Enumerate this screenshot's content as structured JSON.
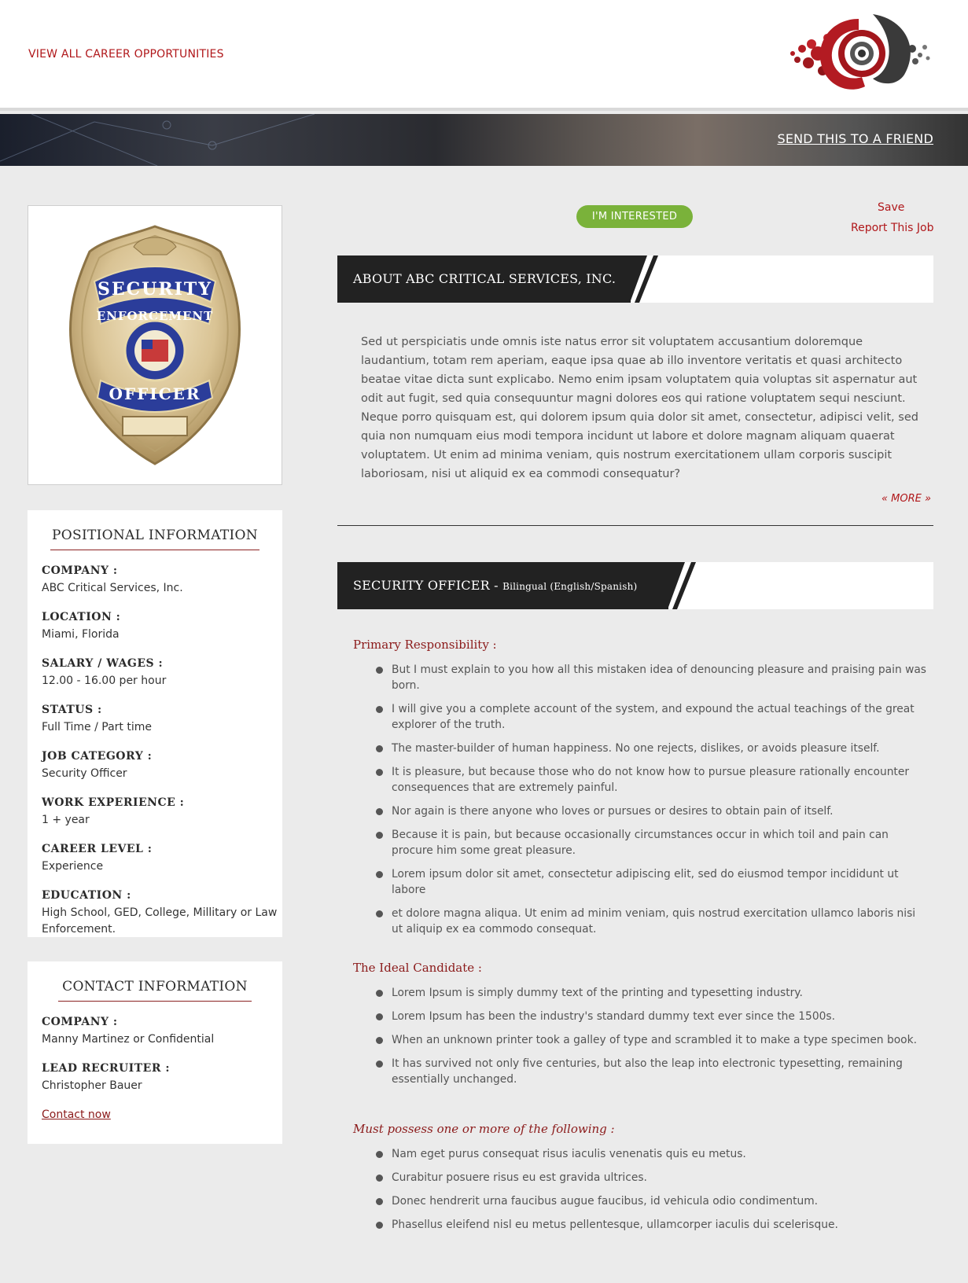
{
  "header": {
    "view_all_label": "VIEW ALL CAREER OPPORTUNITIES",
    "logo_icon": "brand-logo",
    "send_friend_label": "SEND THIS TO A FRIEND"
  },
  "image": {
    "icon": "security-officer-badge",
    "badge_text_top": "SECURITY",
    "badge_text_mid": "ENFORCEMENT",
    "badge_text_bottom": "OFFICER"
  },
  "positional": {
    "title": "POSITIONAL INFORMATION",
    "fields": [
      {
        "label": "COMPANY :",
        "value": "ABC Critical Services, Inc."
      },
      {
        "label": "LOCATION :",
        "value": "Miami, Florida"
      },
      {
        "label": "SALARY / WAGES :",
        "value": "12.00 - 16.00 per hour"
      },
      {
        "label": "STATUS :",
        "value": "Full Time / Part time"
      },
      {
        "label": "JOB CATEGORY :",
        "value": "Security Officer"
      },
      {
        "label": "WORK EXPERIENCE :",
        "value": "1 + year"
      },
      {
        "label": "CAREER LEVEL :",
        "value": "Experience"
      },
      {
        "label": "EDUCATION :",
        "value": "High School, GED, College, Millitary or Law Enforcement."
      }
    ]
  },
  "contact": {
    "title": "CONTACT INFORMATION",
    "fields": [
      {
        "label": "COMPANY :",
        "value": "Manny Martinez or Confidential"
      },
      {
        "label": "LEAD RECRUITER :",
        "value": "Christopher Bauer"
      }
    ],
    "link_label": "Contact now"
  },
  "actions": {
    "interested_label": "I'M INTERESTED",
    "save_label": "Save",
    "report_label": "Report This Job"
  },
  "about": {
    "heading": "ABOUT ABC CRITICAL SERVICES, INC.",
    "text": "Sed ut perspiciatis unde omnis iste natus error sit voluptatem accusantium doloremque laudantium, totam rem aperiam, eaque ipsa quae ab illo inventore veritatis et quasi architecto beatae vitae dicta sunt explicabo. Nemo enim ipsam voluptatem quia voluptas sit aspernatur aut odit aut fugit, sed quia consequuntur magni dolores eos qui ratione voluptatem sequi nesciunt. Neque porro quisquam est, qui dolorem ipsum quia dolor sit amet, consectetur, adipisci velit, sed quia non numquam eius modi tempora incidunt ut labore et dolore magnam aliquam quaerat voluptatem. Ut enim ad minima veniam, quis nostrum exercitationem ullam corporis suscipit laboriosam, nisi ut aliquid ex ea commodi consequatur?",
    "more_label": "« MORE »"
  },
  "job": {
    "heading": "SECURITY OFFICER -",
    "subheading": "Bilingual (English/Spanish)",
    "primary_title": "Primary Responsibility :",
    "primary": [
      "But I must explain to you how all this mistaken idea of denouncing pleasure and praising pain was born.",
      "I will give you a complete account of the system, and expound the actual teachings of the great explorer of the truth.",
      "The master-builder of human happiness. No one rejects, dislikes, or avoids pleasure itself.",
      "It is pleasure, but because those who do not know how to pursue pleasure rationally encounter consequences that are extremely painful.",
      "Nor again is there anyone who loves or pursues or desires to obtain pain of itself.",
      "Because it is pain, but because occasionally circumstances occur in which toil and pain can procure him some great pleasure.",
      "Lorem ipsum dolor sit amet, consectetur adipiscing elit, sed do eiusmod tempor incididunt ut labore",
      "et dolore magna aliqua. Ut enim ad minim veniam, quis nostrud exercitation ullamco laboris nisi ut aliquip ex ea commodo consequat."
    ],
    "ideal_title": "The Ideal Candidate :",
    "ideal": [
      "Lorem Ipsum is simply dummy text of the printing and typesetting industry.",
      "Lorem Ipsum has been the industry's standard dummy text ever since the 1500s.",
      "When an unknown printer took a galley of type and scrambled it to make a type specimen book.",
      "It has survived not only five centuries, but also the leap into electronic typesetting, remaining essentially unchanged."
    ],
    "must_title": "Must possess one or more of the following :",
    "must": [
      "Nam eget purus consequat risus iaculis venenatis quis eu metus.",
      "Curabitur posuere risus eu est gravida ultrices.",
      "Donec hendrerit urna faucibus augue faucibus, id vehicula odio condimentum.",
      "Phasellus eleifend nisl eu metus pellentesque, ullamcorper iaculis dui scelerisque."
    ]
  }
}
